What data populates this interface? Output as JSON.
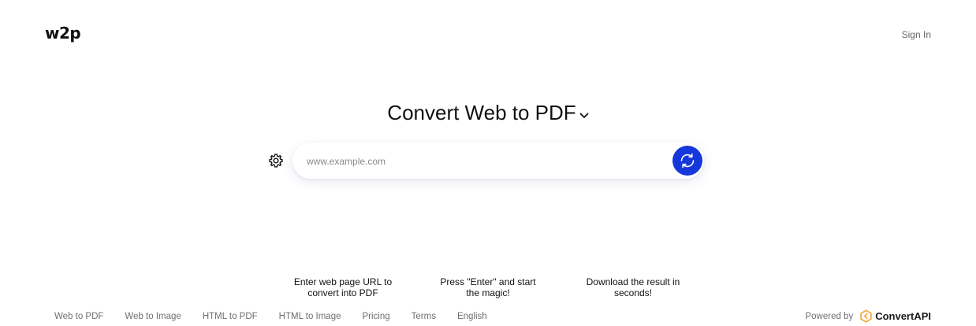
{
  "header": {
    "logo": "w2p",
    "signin_label": "Sign In"
  },
  "main": {
    "title": "Convert Web to PDF",
    "search": {
      "placeholder": "www.example.com",
      "value": ""
    },
    "steps": [
      "Enter web page URL to convert into PDF",
      "Press \"Enter\" and start the magic!",
      "Download the result in seconds!"
    ]
  },
  "footer": {
    "links": [
      "Web to PDF",
      "Web to Image",
      "HTML to PDF",
      "HTML to Image",
      "Pricing",
      "Terms",
      "English"
    ],
    "powered_by": "Powered by",
    "brand": "ConvertAPI"
  },
  "icons": {
    "settings": "gear-icon",
    "convert": "refresh-icon",
    "dropdown": "chevron-down-icon",
    "brand": "convertapi-logo-icon"
  },
  "colors": {
    "accent": "#1537db",
    "brand_orange": "#f2a93b"
  }
}
